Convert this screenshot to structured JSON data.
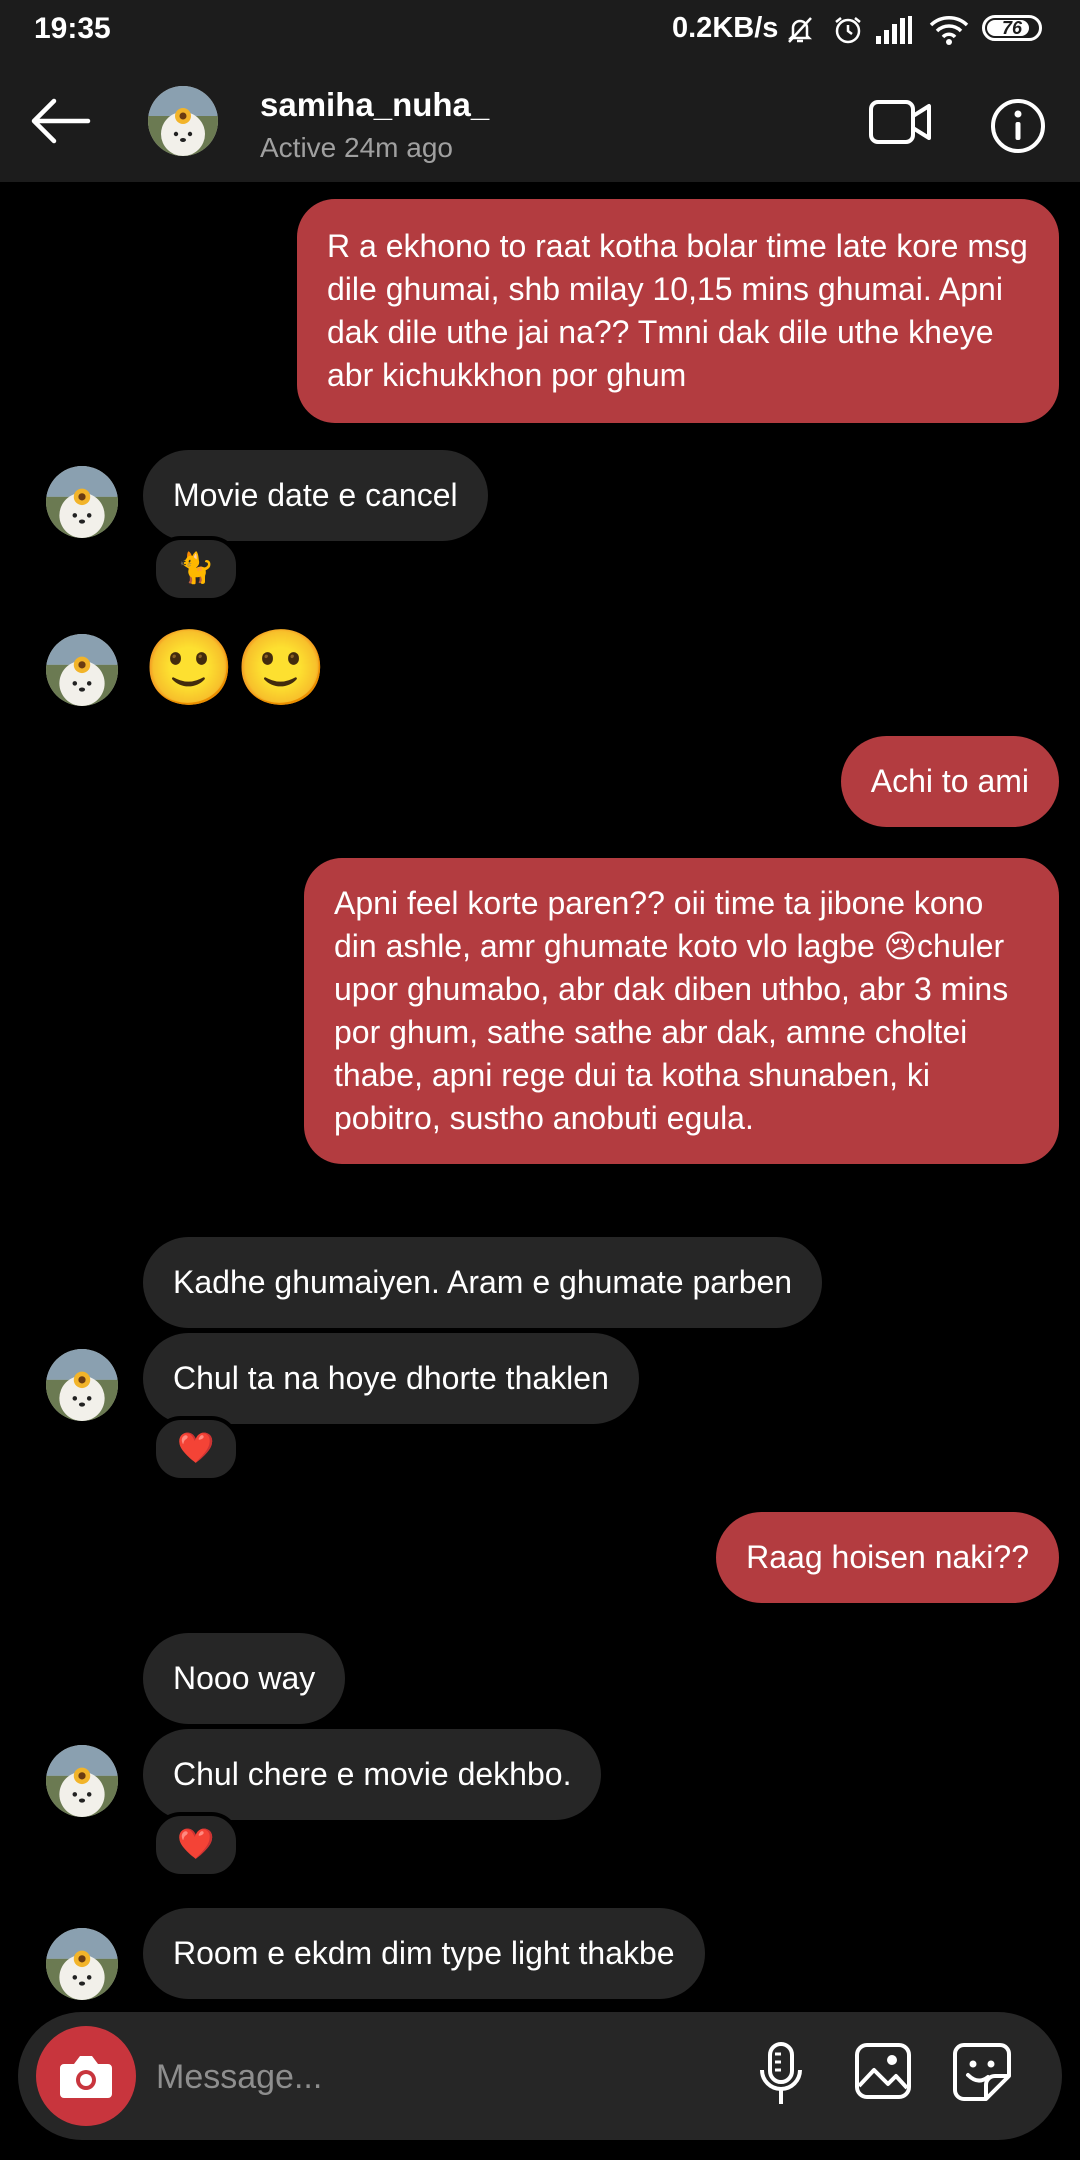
{
  "status_bar": {
    "time": "19:35",
    "network_speed": "0.2KB/s",
    "battery": "76"
  },
  "header": {
    "username": "samiha_nuha_",
    "activity": "Active 24m ago"
  },
  "messages": {
    "m1": "R a ekhono to raat kotha bolar time late kore msg dile ghumai, shb milay 10,15 mins ghumai. Apni dak dile uthe jai na?? Tmni dak dile uthe kheye abr kichukkhon por ghum",
    "m2": "Movie date e cancel",
    "m2_reaction": "🐈",
    "m3": "🙂🙂",
    "m4": "Achi to ami",
    "m5": "Apni feel korte paren?? oii time ta jibone kono din ashle, amr ghumate koto vlo lagbe 😢chuler upor ghumabo, abr dak diben uthbo, abr 3 mins por ghum, sathe sathe abr dak, amne choltei thabe, apni rege dui ta kotha shunaben, ki pobitro, sustho anobuti egula.",
    "m6": "Kadhe ghumaiyen. Aram e ghumate parben",
    "m7": "Chul ta na hoye dhorte thaklen",
    "m7_reaction": "❤️",
    "m8": "Raag hoisen naki??",
    "m9": "Nooo way",
    "m10": "Chul chere e movie dekhbo.",
    "m10_reaction": "❤️",
    "m11": "Room e ekdm dim type light thakbe"
  },
  "composer": {
    "placeholder": "Message..."
  },
  "colors": {
    "sent_bubble": "#b33c40",
    "received_bubble": "#262626",
    "header": "#1c1c1c",
    "camera_button": "#c8353d"
  },
  "icons": [
    "back-arrow-icon",
    "video-call-icon",
    "info-icon",
    "camera-icon",
    "microphone-icon",
    "gallery-icon",
    "sticker-icon"
  ]
}
